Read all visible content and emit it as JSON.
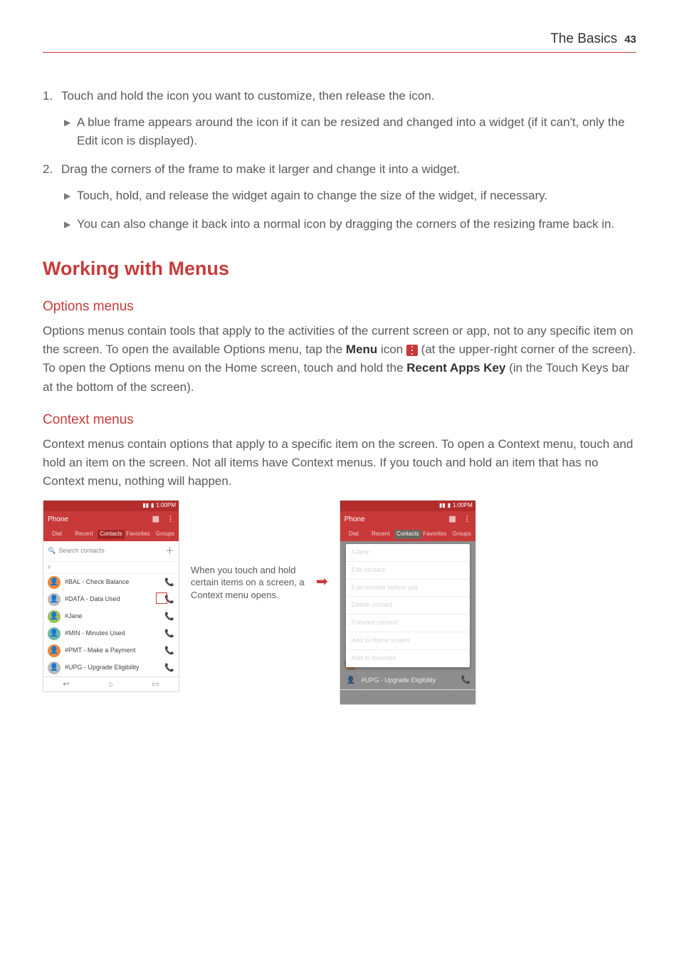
{
  "header": {
    "title": "The Basics",
    "page": "43"
  },
  "step1": {
    "marker": "1.",
    "text": "Touch and hold the icon you want to customize, then release the icon.",
    "bullets": [
      "A blue frame appears around the icon if it can be resized and changed into a widget (if it can't, only the Edit icon is displayed)."
    ]
  },
  "step2": {
    "marker": "2.",
    "text": "Drag the corners of the frame to make it larger and change it into a widget.",
    "bullets": [
      "Touch, hold, and release the widget again to change the size of the widget, if necessary.",
      "You can also change it back into a normal icon by dragging the corners of the resizing frame back in."
    ]
  },
  "sectionHeading": "Working with Menus",
  "options": {
    "heading": "Options menus",
    "p_a": "Options menus contain tools that apply to the activities of the current screen or app, not to any specific item on the screen. To open the available Options menu, tap the ",
    "menu_bold": "Menu",
    "p_b": " icon ",
    "p_c": " (at the upper-right corner of the screen). To open the Options menu on the Home screen, touch and hold the ",
    "recent_bold": "Recent Apps Key",
    "p_d": " (in the Touch Keys bar at the bottom of the screen)."
  },
  "context": {
    "heading": "Context menus",
    "text": "Context menus contain options that apply to a specific item on the screen. To open a Context menu, touch and hold an item on the screen. Not all items have Context menus. If you touch and hold an item that has no Context menu, nothing will happen."
  },
  "figure": {
    "time": "1:00PM",
    "app": "Phone",
    "tabs": [
      "Dial",
      "Recent",
      "Contacts",
      "Favorites",
      "Groups"
    ],
    "search": "Search contacts",
    "divider": "#",
    "contacts": [
      "#BAL - Check Balance",
      "#DATA - Data Used",
      "#Jane",
      "#MIN - Minutes Used",
      "#PMT - Make a Payment",
      "#UPG - Upgrade Eligibility"
    ],
    "caption": "When you touch and hold certain items on a screen, a Context menu opens.",
    "ctxTitle": "#Jane",
    "ctxItems": [
      "Edit contact",
      "Edit number before call",
      "Delete contact",
      "Forward contact",
      "Add to Home screen",
      "Add to favorites"
    ],
    "remaining": [
      "#PMT - Make a Payment",
      "#UPG - Upgrade Eligibility"
    ]
  }
}
